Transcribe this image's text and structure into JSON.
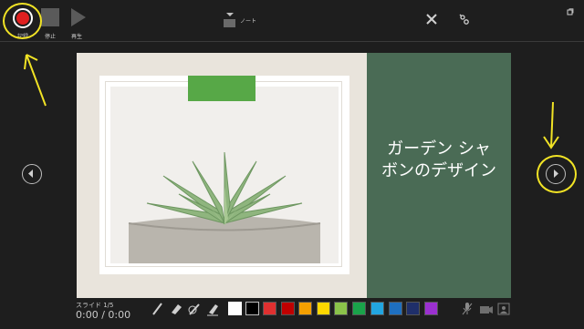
{
  "toolbar": {
    "record_label": "記録",
    "stop_label": "停止",
    "play_label": "再生",
    "notes_label": "ノート"
  },
  "slide": {
    "title": "ガーデン シャボンのデザイン",
    "title_line1": "ガーデン シャ",
    "title_line2": "ボンのデザイン"
  },
  "status": {
    "slide_number": "スライド 1/5",
    "timer": "0:00 / 0:00"
  },
  "colors": {
    "record_red": "#e02020",
    "slide_panel": "#4a6b55",
    "tab_green": "#57a847",
    "annotation": "#f1e325",
    "palette": [
      "#ffffff",
      "#000000",
      "#e03030",
      "#c00000",
      "#f5a000",
      "#ffd800",
      "#8bc34a",
      "#1aa34a",
      "#22a5e0",
      "#1e6fc0",
      "#1f2f6a",
      "#9b30d0"
    ]
  },
  "icons": {
    "pens": [
      "pen-icon",
      "eraser-icon",
      "laser-pointer-icon",
      "highlighter-icon"
    ],
    "right_tools": [
      "microphone-icon",
      "camera-icon",
      "camera-preview-icon"
    ]
  }
}
